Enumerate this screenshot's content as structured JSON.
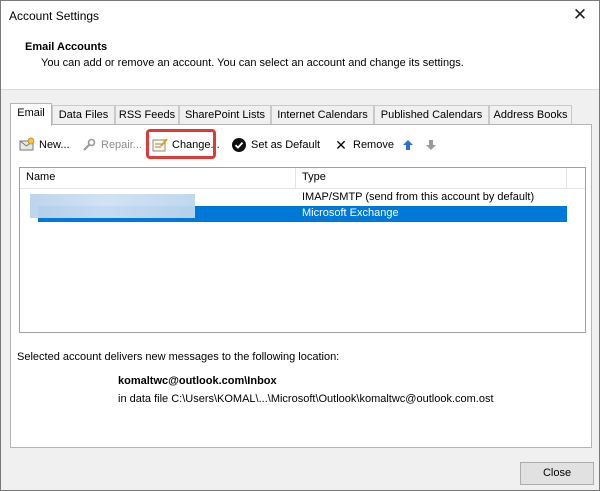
{
  "window": {
    "title": "Account Settings",
    "close_glyph": "✕"
  },
  "header": {
    "title": "Email Accounts",
    "description": "You can add or remove an account. You can select an account and change its settings."
  },
  "tabs": [
    {
      "label": "Email",
      "active": true
    },
    {
      "label": "Data Files"
    },
    {
      "label": "RSS Feeds"
    },
    {
      "label": "SharePoint Lists"
    },
    {
      "label": "Internet Calendars"
    },
    {
      "label": "Published Calendars"
    },
    {
      "label": "Address Books"
    }
  ],
  "toolbar": {
    "new_label": "New...",
    "repair_label": "Repair...",
    "change_label": "Change...",
    "default_label": "Set as Default",
    "remove_label": "Remove",
    "remove_glyph": "✕",
    "up_glyph": "🡅",
    "down_glyph": "🡇"
  },
  "list": {
    "columns": [
      "Name",
      "Type"
    ],
    "rows": [
      {
        "name": "",
        "type": "IMAP/SMTP (send from this account by default)",
        "selected": false
      },
      {
        "name": "",
        "type": "Microsoft Exchange",
        "selected": true
      }
    ]
  },
  "delivery": {
    "label": "Selected account delivers new messages to the following location:",
    "email": "komaltwc@outlook.com\\Inbox",
    "file": "in data file C:\\Users\\KOMAL\\...\\Microsoft\\Outlook\\komaltwc@outlook.com.ost"
  },
  "footer": {
    "close_label": "Close"
  },
  "colors": {
    "accent": "#0078d7",
    "highlight_box": "#e03a36"
  }
}
